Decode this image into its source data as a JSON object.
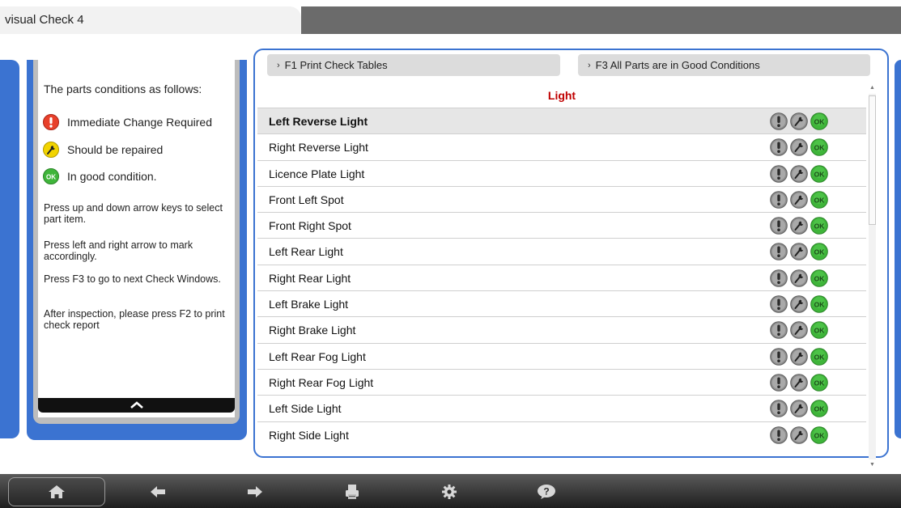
{
  "window": {
    "title": "visual Check 4"
  },
  "help": {
    "heading": "The parts conditions as follows:",
    "legend": [
      {
        "icon": "exclamation-icon",
        "label": "Immediate Change Required",
        "color": "#e8402a"
      },
      {
        "icon": "wrench-icon",
        "label": "Should be repaired",
        "color": "#f2d400"
      },
      {
        "icon": "ok-icon",
        "label": "In good condition.",
        "color": "#3fb53a"
      }
    ],
    "instructions": [
      "Press up and down arrow keys to select part item.",
      "Press left and right arrow to mark accordingly.",
      "Press F3 to go to next Check Windows.",
      "After inspection, please press F2 to print check report"
    ]
  },
  "function_keys": {
    "f1_label": "F1  Print Check Tables",
    "f3_label": "F3  All Parts are in Good Conditions"
  },
  "category": "Light",
  "parts": [
    "Left Reverse Light",
    "Right Reverse Light",
    "Licence Plate Light",
    "Front Left  Spot",
    "Front Right Spot",
    "Left Rear Light",
    "Right Rear Light",
    "Left Brake Light",
    "Right Brake Light",
    "Left Rear Fog Light",
    "Right Rear Fog Light",
    "Left Side Light",
    "Right Side Light"
  ],
  "status_buttons": {
    "ok_text": "OK"
  },
  "toolbar": [
    "home-icon",
    "back-arrow-icon",
    "forward-arrow-icon",
    "printer-icon",
    "gear-icon",
    "help-icon"
  ],
  "colors": {
    "accent": "#3b73d1",
    "category": "#c00000",
    "ok": "#3fb53a"
  }
}
